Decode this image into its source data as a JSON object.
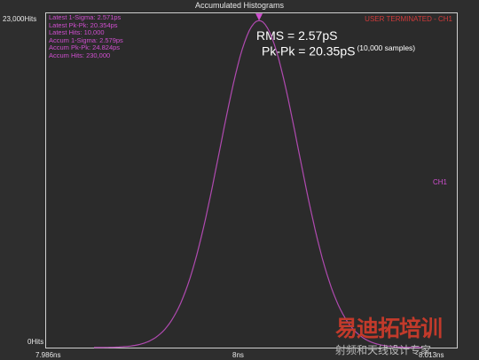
{
  "window": {
    "title": "Accumulated Histograms"
  },
  "y_axis": {
    "top_label": "23,000Hits",
    "bottom_label": "0Hits"
  },
  "x_axis": {
    "left_label": "7.986ns",
    "center_label": "8ns",
    "right_label": "8.013ns"
  },
  "stats": [
    "Latest 1-Sigma: 2.571ps",
    "Latest Pk-Pk: 20.354ps",
    "Latest Hits: 10,000",
    "Accum 1-Sigma: 2.579ps",
    "Accum Pk-Pk: 24.824ps",
    "Accum Hits: 230,000"
  ],
  "status": "USER TERMINATED - CH1",
  "channel_label": "CH1",
  "annotation": {
    "rms": "RMS = 2.57pS",
    "pkpk": "Pk-Pk = 20.35pS",
    "samples": "(10,000 samples)"
  },
  "histogram": {
    "unit": "ns",
    "xmin": 7.986,
    "xmax": 8.013,
    "ymax": 23000,
    "mean": 8.0,
    "sigma": 0.00258,
    "peak_hits": 22500,
    "color": "#b04ab0"
  },
  "watermark": {
    "line1": "易迪拓培训",
    "line2": "射频和天线设计专家"
  },
  "colors": {
    "stats": "#d04fd0",
    "status": "#d23a3a",
    "annotation": "#ffffff"
  }
}
